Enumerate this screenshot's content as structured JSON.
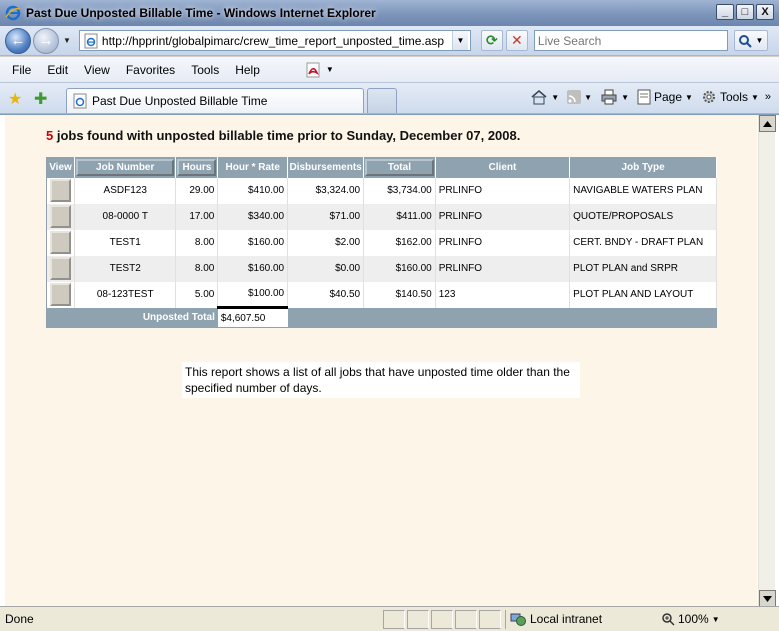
{
  "window": {
    "title": "Past Due Unposted Billable Time - Windows Internet Explorer",
    "minimize": "_",
    "maximize": "□",
    "close": "X"
  },
  "address": {
    "url": "http://hpprint/globalpimarc/crew_time_report_unposted_time.asp",
    "search_placeholder": "Live Search"
  },
  "menu": {
    "file": "File",
    "edit": "Edit",
    "view": "View",
    "favorites": "Favorites",
    "tools": "Tools",
    "help": "Help"
  },
  "tab": {
    "label": "Past Due Unposted Billable Time"
  },
  "commands": {
    "page": "Page",
    "tools": "Tools"
  },
  "report": {
    "count": "5",
    "headline": " jobs found with unposted billable time prior to Sunday, December 07, 2008.",
    "columns": [
      "View",
      "Job Number",
      "Hours",
      "Hour * Rate",
      "Disbursements",
      "Total",
      "Client",
      "Job Type"
    ],
    "rows": [
      {
        "job": "ASDF123",
        "hours": "29.00",
        "rate": "$410.00",
        "disb": "$3,324.00",
        "total": "$3,734.00",
        "client": "PRLINFO",
        "type": "NAVIGABLE WATERS PLAN"
      },
      {
        "job": "08-0000 T",
        "hours": "17.00",
        "rate": "$340.00",
        "disb": "$71.00",
        "total": "$411.00",
        "client": "PRLINFO",
        "type": "QUOTE/PROPOSALS"
      },
      {
        "job": "TEST1",
        "hours": "8.00",
        "rate": "$160.00",
        "disb": "$2.00",
        "total": "$162.00",
        "client": "PRLINFO",
        "type": "CERT. BNDY - DRAFT PLAN"
      },
      {
        "job": "TEST2",
        "hours": "8.00",
        "rate": "$160.00",
        "disb": "$0.00",
        "total": "$160.00",
        "client": "PRLINFO",
        "type": "PLOT PLAN and SRPR"
      },
      {
        "job": "08-123TEST",
        "hours": "5.00",
        "rate": "$100.00",
        "disb": "$40.50",
        "total": "$140.50",
        "client": "123",
        "type": "PLOT PLAN AND LAYOUT"
      }
    ],
    "total_label": "Unposted Total",
    "total_value": "$4,607.50",
    "note": "This report shows a list of all jobs that have unposted time older than the specified number of days."
  },
  "status": {
    "text": "Done",
    "zone": "Local intranet",
    "zoom": "100%"
  },
  "colors": {
    "content_bg": "#fef5e9",
    "header_bg": "#8fa2af",
    "count_red": "#cc0000"
  }
}
